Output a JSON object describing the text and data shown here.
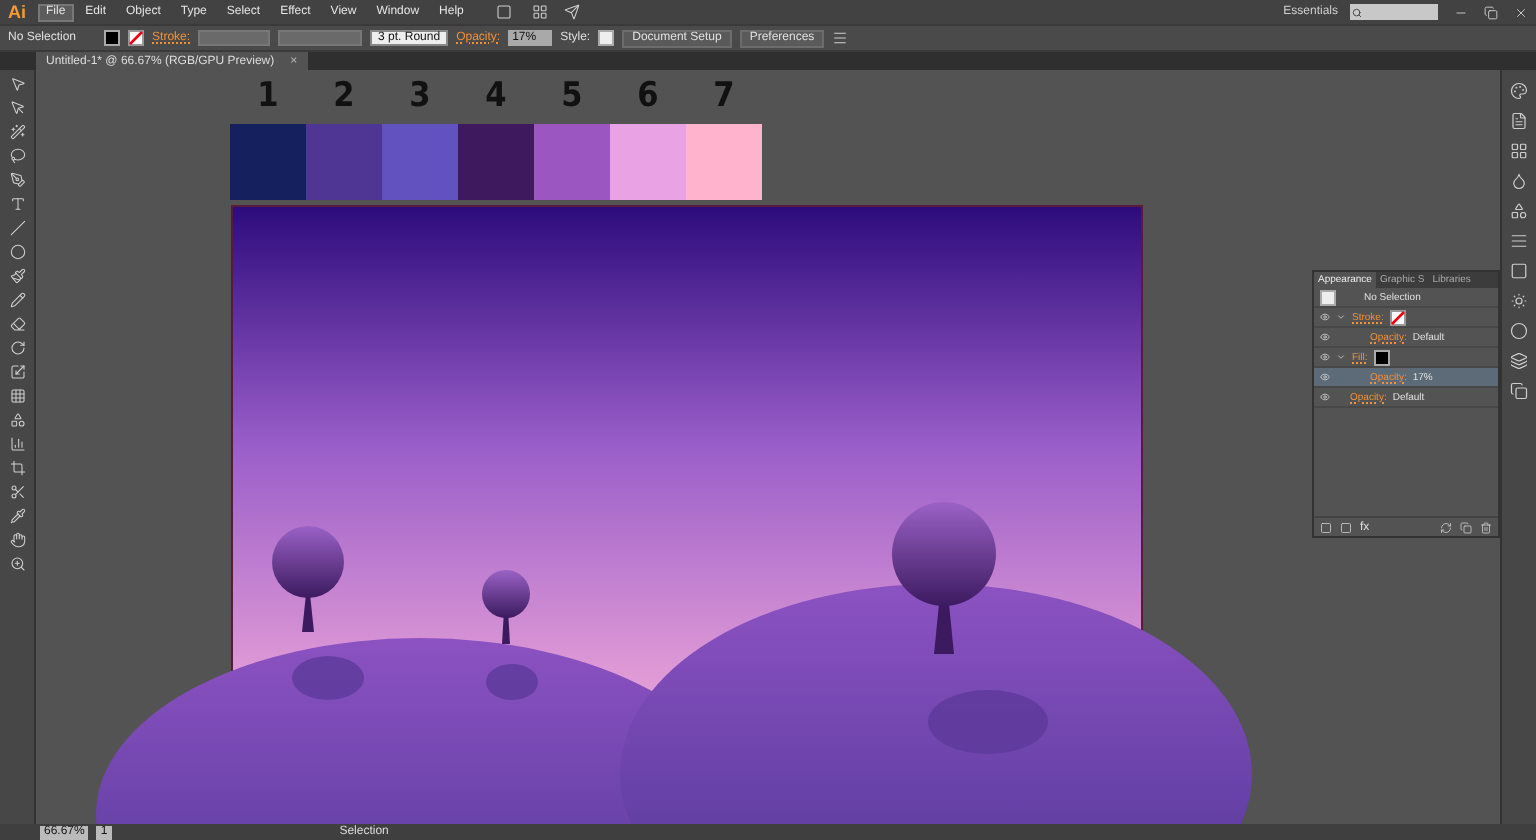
{
  "app": {
    "logo": "Ai",
    "workspace": "Essentials"
  },
  "menu": [
    {
      "label": "File",
      "selected": true
    },
    {
      "label": "Edit",
      "selected": false
    },
    {
      "label": "Object",
      "selected": false
    },
    {
      "label": "Type",
      "selected": false
    },
    {
      "label": "Select",
      "selected": false
    },
    {
      "label": "Effect",
      "selected": false
    },
    {
      "label": "View",
      "selected": false
    },
    {
      "label": "Window",
      "selected": false
    },
    {
      "label": "Help",
      "selected": false
    }
  ],
  "control_bar": {
    "selection": "No Selection",
    "stroke_label": "Stroke:",
    "brush": "3 pt. Round",
    "opacity_label": "Opacity:",
    "opacity": "17%",
    "style_label": "Style:",
    "buttons": [
      "Document Setup",
      "Preferences"
    ]
  },
  "document_tab": {
    "title": "Untitled-1* @ 66.67% (RGB/GPU Preview)",
    "close": "×"
  },
  "swatches": [
    {
      "label": "1",
      "color": "#15205f"
    },
    {
      "label": "2",
      "color": "#4f3594"
    },
    {
      "label": "3",
      "color": "#6152c0"
    },
    {
      "label": "4",
      "color": "#3e195d"
    },
    {
      "label": "5",
      "color": "#9b56c1"
    },
    {
      "label": "6",
      "color": "#e9a2e4"
    },
    {
      "label": "7",
      "color": "#ffb3cc"
    }
  ],
  "appearance_panel": {
    "tabs": [
      {
        "label": "Appearance",
        "selected": true
      },
      {
        "label": "Graphic S",
        "selected": false
      },
      {
        "label": "Libraries",
        "selected": false
      }
    ],
    "header": "No Selection",
    "rows": [
      {
        "kind": "stroke_attribute",
        "label": "Stroke:",
        "selected": false
      },
      {
        "kind": "opacity",
        "label": "Opacity:",
        "value": "Default",
        "selected": false
      },
      {
        "kind": "fill_attribute",
        "label": "Fill:",
        "selected": false
      },
      {
        "kind": "opacity",
        "label": "Opacity:",
        "value": "17%",
        "selected": true
      },
      {
        "kind": "opacity_top",
        "label": "Opacity:",
        "value": "Default",
        "selected": false
      }
    ],
    "footer_label": "fx"
  },
  "status_bar": {
    "zoom": "66.67%",
    "artboard": "1",
    "tool": "Selection"
  }
}
